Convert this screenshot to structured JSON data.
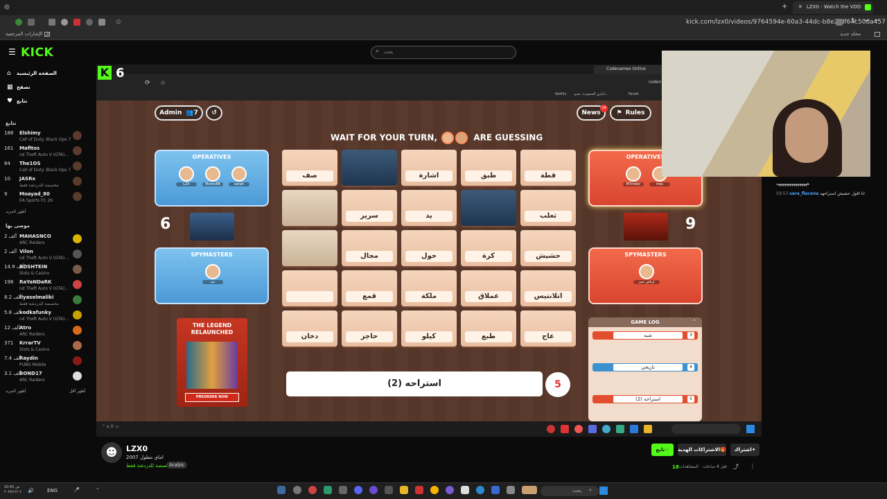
{
  "browser": {
    "tab_title": "LZX0 - Watch the VOD on",
    "url": "kick.com/lzx0/videos/9764594e-60a3-44dc-b8e2-df64c50da457",
    "bookmarks_all": "كل الإشارات المرجعية",
    "bookmarks_folder": "مجلد جديد"
  },
  "kick": {
    "logo": "KICK",
    "search_placeholder": "بحث"
  },
  "sidebar": {
    "nav": [
      {
        "label": "الصفحة الرئيسية",
        "icon": "home-icon"
      },
      {
        "label": "تصفح",
        "icon": "browse-icon"
      },
      {
        "label": "تتابع",
        "icon": "heart-icon"
      }
    ],
    "following_heading": "تتابع",
    "following": [
      {
        "name": "Elshimy",
        "game": "Call of Duty: Black Ops 7",
        "count": "188"
      },
      {
        "name": "Mafitos",
        "game": "...nd Theft Auto V (GTA)",
        "count": "161"
      },
      {
        "name": "The1OS",
        "game": "Call of Duty: Black Ops 7",
        "count": "84"
      },
      {
        "name": "JASRx",
        "game": "مخصصة للدردشة فقط",
        "count": "10"
      },
      {
        "name": "Moayad_80",
        "game": "EA Sports FC 26",
        "count": "9"
      }
    ],
    "show_more_1": "أظهر المزيد",
    "recommended_heading": "موصى بها",
    "recommended": [
      {
        "name": "MAHASNCO",
        "game": "ARC Raiders",
        "count": "2 ألف"
      },
      {
        "name": "Vilon",
        "game": "...nd Theft Auto V (GTA)",
        "count": "2 ألف"
      },
      {
        "name": "ROSHTEIN",
        "game": "Slots & Casino",
        "count": "14.9 ألف"
      },
      {
        "name": "RaYaNDaRK",
        "game": "...nd Theft Auto V (GTA)",
        "count": "198"
      },
      {
        "name": "Ilyaselmaliki",
        "game": "مخصصة للدردشة فقط",
        "count": "8.2 ألف"
      },
      {
        "name": "vodkafunky",
        "game": "...nd Theft Auto V (GTA)",
        "count": "5.8 ألف"
      },
      {
        "name": "Atro",
        "game": "ARC Raiders",
        "count": "12 ألف"
      },
      {
        "name": "KrrarTV",
        "game": "Slots & Casino",
        "count": "371"
      },
      {
        "name": "Raydin",
        "game": "PUBG Mobile",
        "count": "7.4 ألف"
      },
      {
        "name": "BOND17",
        "game": "ARC Raiders",
        "count": "3.1 ألف"
      }
    ],
    "show_more_2": "أظهر المزيد",
    "show_less": "أظهر أقل"
  },
  "stream": {
    "overlay_number": "6",
    "inner_tab": "Codenames Online",
    "inner_bookmark": "Netflix",
    "inner_bookmark2": "Faceit",
    "inner_bookmark3": "أماري السعودية: تسو...",
    "inner_url": "coden",
    "admin_label": "Admin",
    "players_count": "7",
    "news_label": "News",
    "news_badge": "24",
    "rules_label": "Rules",
    "turn_message_1": "WAIT FOR YOUR TURN,",
    "turn_message_2": "ARE GUESSING",
    "blue_team": {
      "operatives_title": "OPERATIVES",
      "operatives": [
        "LZX",
        "Memo88",
        "sarah"
      ],
      "spymasters_title": "SPYMASTERS",
      "spymaster": "عبد",
      "score": "6"
    },
    "red_team": {
      "operatives_title": "OPERATIVES",
      "operatives": [
        "M7mdor",
        "tres"
      ],
      "spymasters_title": "SPYMASTERS",
      "spymaster": "ارياص عبير",
      "score": "9"
    },
    "cards": [
      [
        "صف",
        "",
        "اشارة",
        "طبق",
        "قطة"
      ],
      [
        "",
        "سرير",
        "يد",
        "",
        "ثعلب"
      ],
      [
        "",
        "مجال",
        "حول",
        "كرة",
        "حشيش"
      ],
      [
        "",
        "قمع",
        "ملكة",
        "عملاق",
        "اتلانتيس"
      ],
      [
        "دخان",
        "حاجز",
        "كيلو",
        "طبع",
        "عاج"
      ]
    ],
    "clue_word": "استراحه (2)",
    "clue_count": "5",
    "promo_title": "THE LEGEND RELAUNCHED",
    "promo_button": "PREORDER NOW",
    "game_log_title": "GAME LOG",
    "game_log": [
      {
        "word": "شبه",
        "num": "3",
        "team": "red"
      },
      {
        "word": "تاريخي",
        "num": "4",
        "team": "blue"
      },
      {
        "word": "استراحه (2)",
        "num": "5",
        "team": "red"
      }
    ]
  },
  "chat": {
    "line_time": "59:53",
    "line_user": "sara_flacona",
    "line_text": "انا اقول حشيش استراحهه",
    "top_text": "ههههههههههههههههه"
  },
  "channel": {
    "name": "LZX0",
    "title": "2007 اماي مطول",
    "category": "مخصصة للدردشة فقط",
    "language_tag": "Arabic",
    "follow_label": "تابع",
    "gift_label": "الاشتراكات الهدية",
    "subscribe_label": "اشتراك",
    "time_ago": "قبل 4 ساعات",
    "views_label": "المشاهدات",
    "views_count": "18"
  },
  "taskbar": {
    "language": "ENG",
    "search_placeholder": "بحث",
    "time": "10:41 ص",
    "date": "٢٠٢٥/١٢/٠٧"
  },
  "colors": {
    "kick_green": "#53fc18",
    "blue_team": "#4b99d6",
    "red_team": "#e04a30"
  }
}
